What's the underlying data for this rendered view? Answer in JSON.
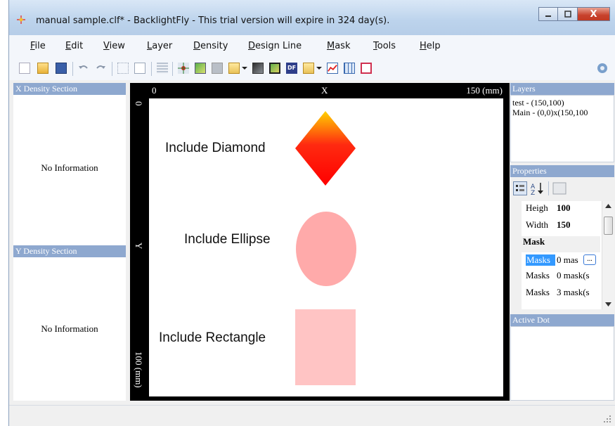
{
  "window": {
    "title": "manual sample.clf* - BacklightFly - This trial version will expire in 324 day(s).",
    "minimize_icon": "minimize-icon",
    "maximize_icon": "maximize-icon",
    "close_label": "X"
  },
  "menu": {
    "items": [
      "File",
      "Edit",
      "View",
      "Layer",
      "Density",
      "Design Line",
      "Mask",
      "Tools",
      "Help"
    ]
  },
  "toolbar": {
    "icons": [
      "new-file-icon",
      "open-folder-icon",
      "save-icon",
      "undo-icon",
      "redo-icon",
      "select-box-icon",
      "page-icon",
      "align-icon",
      "dot-grid-icon",
      "green-map-icon",
      "gray-box-icon",
      "open-dropdown-icon",
      "dark-map-icon",
      "green-map-selected-icon",
      "df-icon",
      "open-dropdown-2-icon",
      "chart-icon",
      "table-icon",
      "export-icon",
      "settings-icon"
    ],
    "df_text": "DF"
  },
  "left_panel": {
    "x_density_title": "X Density Section",
    "x_density_info": "No Information",
    "y_density_title": "Y Density Section",
    "y_density_info": "No Information"
  },
  "canvas": {
    "ruler_x_start": "0",
    "ruler_x_axis": "X",
    "ruler_x_end": "150 (mm)",
    "ruler_y_start": "0",
    "ruler_y_axis": "Y",
    "ruler_y_end": "100 (mm)",
    "shapes": [
      {
        "label": "Include Diamond",
        "shape": "diamond",
        "color_top": "#ffd200",
        "color_bottom": "#ff0000"
      },
      {
        "label": "Include Ellipse",
        "shape": "ellipse",
        "color": "#ffaaaa"
      },
      {
        "label": "Include Rectangle",
        "shape": "rectangle",
        "color": "#ffc4c4"
      }
    ]
  },
  "layers": {
    "title": "Layers",
    "items": [
      "test - (150,100)",
      "Main - (0,0)x(150,100"
    ]
  },
  "properties": {
    "title": "Properties",
    "rows": [
      {
        "key": "Heigh",
        "value": "100"
      },
      {
        "key": "Width",
        "value": "150"
      }
    ],
    "mask_section": "Mask",
    "mask_rows": [
      {
        "key": "Masks",
        "value": "0 mas"
      },
      {
        "key": "Masks",
        "value": "0 mask(s"
      },
      {
        "key": "Masks",
        "value": "3 mask(s"
      }
    ],
    "ellipsis_label": "..."
  },
  "active_dot": {
    "title": "Active Dot"
  },
  "colors": {
    "panel_header": "#8ea8cf",
    "selection": "#3399ff",
    "canvas_frame": "#000000"
  }
}
